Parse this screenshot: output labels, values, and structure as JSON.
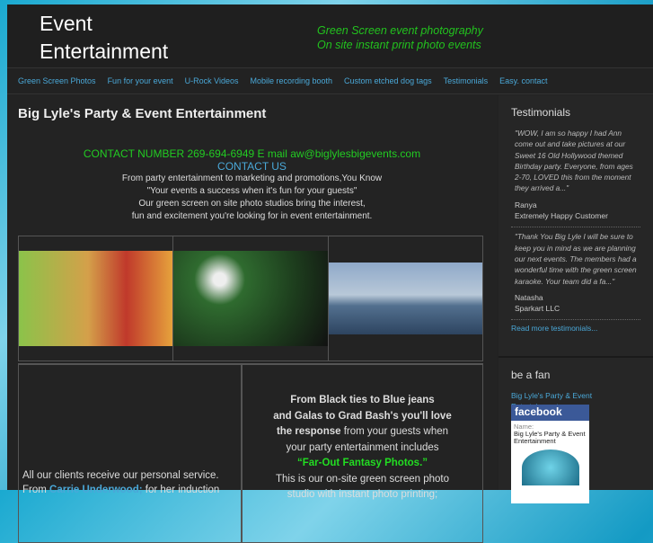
{
  "header": {
    "logo_line1": "Event",
    "logo_line2": "Entertainment",
    "tagline1": "Green Screen event photography",
    "tagline2": "On site instant print photo events"
  },
  "nav": [
    "Green Screen Photos",
    "Fun for your event",
    "U-Rock Videos",
    "Mobile recording booth",
    "Custom etched dog tags",
    "Testimonials",
    "Easy. contact"
  ],
  "main": {
    "title": "Big Lyle's Party & Event Entertainment",
    "contact": "CONTACT NUMBER 269-694-6949 E mail aw@biglylesbigevents.com",
    "contact_us": "CONTACT US",
    "intro": [
      "From party entertainment to marketing and promotions,You Know",
      "\"Your events a success when it's fun for your guests\"",
      "Our green screen on site photo studios bring the interest,",
      "fun and excitement you're looking for in event entertainment."
    ],
    "left_text": "All our clients receive our personal service.",
    "left_from": "From",
    "left_link": "Carrie Underwood;",
    "left_rest": "for her induction",
    "right_b1": "From Black ties to Blue jeans",
    "right_b2": "and Galas to Grad Bash's you'll love",
    "right_b3": "the response",
    "right_r3": " from your guests when",
    "right_4": "your party entertainment includes",
    "right_green": "“Far-Out Fantasy Photos.”",
    "right_6": "This is our on-site green screen photo",
    "right_7": "studio with instant photo printing;"
  },
  "sidebar": {
    "testimonials_title": "Testimonials",
    "testimonials": [
      {
        "quote": "\"WOW, I am so happy I had Ann come out and take pictures at our Sweet 16 Old Hollywood themed Birthday party. Everyone, from ages 2-70, LOVED this from the moment they arrived a...\"",
        "name": "Ranya",
        "title": "Extremely Happy Customer"
      },
      {
        "quote": "\"Thank You Big Lyle I will be sure to keep you in mind as we are planning our next events. The members had a wonderful time with the green screen karaoke. Your team did a fa...\"",
        "name": "Natasha",
        "title": "Sparkart LLC"
      }
    ],
    "read_more": "Read more testimonials...",
    "fan_title": "be a fan",
    "fan_link": "Big Lyle's Party & Event Entertainment",
    "fb_brand": "facebook",
    "fb_name_label": "Name:",
    "fb_name": "Big Lyle's Party & Event Entertainment"
  }
}
